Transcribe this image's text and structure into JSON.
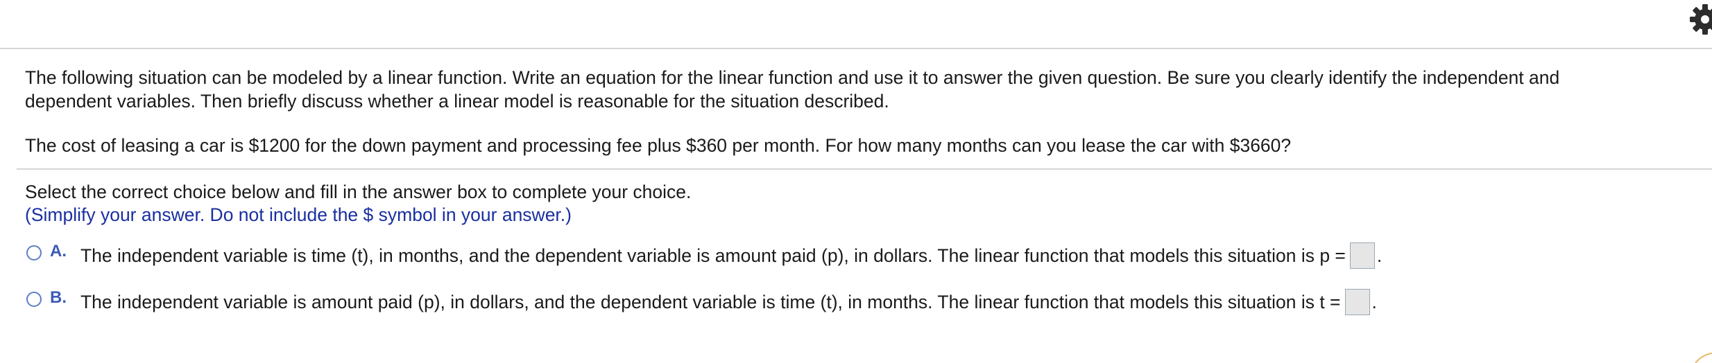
{
  "problem": {
    "intro_line1": "The following situation can be modeled by a linear function. Write an equation for the linear function and use it to answer the given question. Be sure you clearly identify the independent and",
    "intro_line2": "dependent variables. Then briefly discuss whether a linear model is reasonable for the situation described.",
    "scenario": "The cost of leasing a car is $1200 for the down payment and processing fee plus $360 per month. For how many months can you lease the car with $3660?"
  },
  "answer": {
    "instruction": "Select the correct choice below and fill in the answer box to complete your choice.",
    "hint": "(Simplify your answer. Do not include the $ symbol in your answer.)",
    "choices": [
      {
        "letter": "A.",
        "text": "The independent variable is time (t), in months, and the dependent variable is amount paid (p), in dollars. The linear function that models this situation is p =",
        "value": ""
      },
      {
        "letter": "B.",
        "text": "The independent variable is amount paid (p), in dollars, and the dependent variable is time (t), in months. The linear function that models this situation is t =",
        "value": ""
      }
    ],
    "period": "."
  },
  "colors": {
    "hint": "#1a2fa0",
    "choice_letter": "#3b5bb5",
    "radio_border": "#5b7fc7",
    "rule": "#d6d6d6",
    "answer_box": "#e6e6e6"
  },
  "icons": {
    "settings": "gear-icon"
  }
}
